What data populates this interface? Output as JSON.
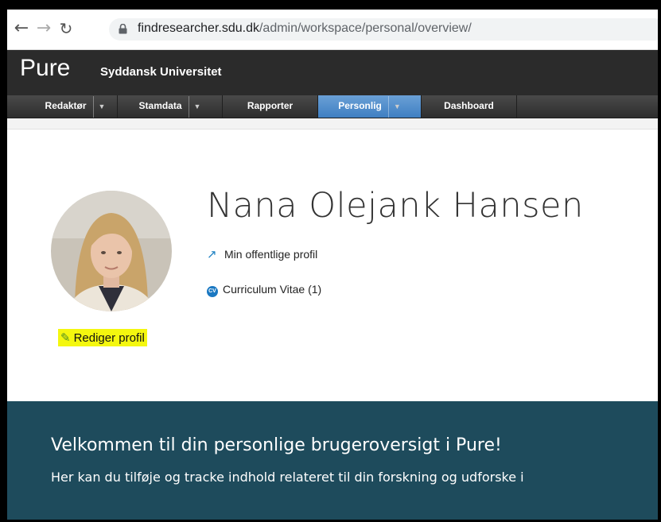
{
  "browser": {
    "url_domain": "findresearcher.sdu.dk",
    "url_path": "/admin/workspace/personal/overview/"
  },
  "header": {
    "logo": "Pure",
    "organization": "Syddansk Universitet"
  },
  "menu": {
    "items": [
      {
        "label": "Redaktør",
        "has_dropdown": true,
        "active": false
      },
      {
        "label": "Stamdata",
        "has_dropdown": true,
        "active": false
      },
      {
        "label": "Rapporter",
        "has_dropdown": false,
        "active": false
      },
      {
        "label": "Personlig",
        "has_dropdown": true,
        "active": true
      },
      {
        "label": "Dashboard",
        "has_dropdown": false,
        "active": false
      }
    ]
  },
  "profile": {
    "name": "Nana Olejank Hansen",
    "public_profile_link": "Min offentlige profil",
    "cv_icon_label": "CV",
    "cv_link": "Curriculum Vitae (1)",
    "edit_profile": "Rediger profil"
  },
  "welcome": {
    "title": "Velkommen til din personlige brugeroversigt i Pure!",
    "text": "Her kan du tilføje og tracke indhold relateret til din forskning og udforske i"
  },
  "colors": {
    "menu_active": "#3f7fc2",
    "welcome_bg": "#1e4b5c",
    "highlight": "#f4f70f",
    "link_icon": "#1a7fc1"
  }
}
